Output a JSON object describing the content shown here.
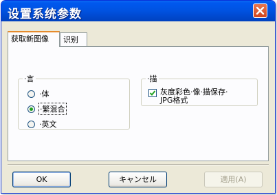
{
  "window": {
    "title": "设置系统参数"
  },
  "tabs": [
    {
      "label": "获取新图像",
      "active": true
    },
    {
      "label": "识别",
      "active": false
    }
  ],
  "group_mode": {
    "legend": "·言",
    "options": [
      {
        "label": "·体",
        "checked": false
      },
      {
        "label": "·繁混合",
        "checked": true
      },
      {
        "label": "·英文",
        "checked": false
      }
    ]
  },
  "group_save": {
    "legend": "·描",
    "checkbox_line1": "灰度彩色·像·描保存·",
    "checkbox_line2": "JPG格式",
    "checked": true
  },
  "buttons": {
    "ok": "OK",
    "cancel": "キャンセル",
    "apply": "適用(A)"
  }
}
